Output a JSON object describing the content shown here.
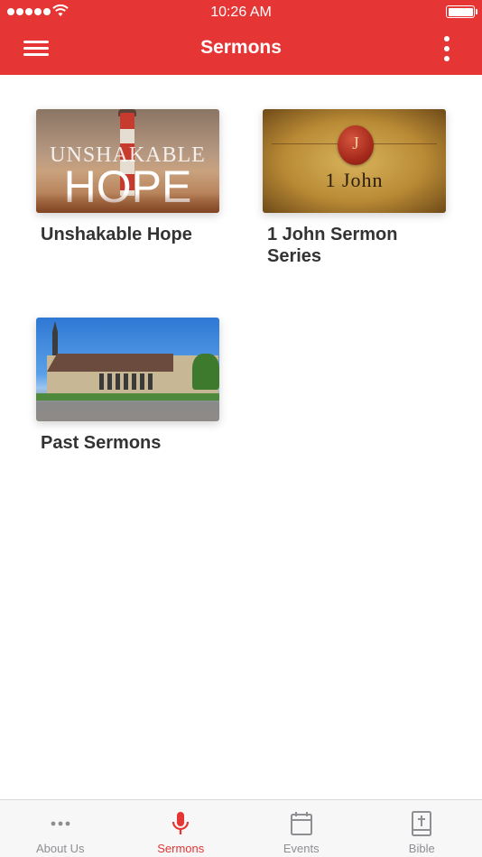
{
  "status_bar": {
    "time": "10:26 AM"
  },
  "header": {
    "title": "Sermons",
    "background_color": "#e63535",
    "menu_icon": "hamburger-menu-icon",
    "more_icon": "more-vertical-icon"
  },
  "sermons": [
    {
      "title": "Unshakable Hope",
      "thumbnail_text_top": "UNSHAKABLE",
      "thumbnail_text_bottom": "HOPE"
    },
    {
      "title": "1 John Sermon Series",
      "thumbnail_seal_letter": "J",
      "thumbnail_text": "1 John"
    },
    {
      "title": "Past Sermons"
    }
  ],
  "tabs": [
    {
      "label": "About Us",
      "icon": "more-dots-icon",
      "active": false
    },
    {
      "label": "Sermons",
      "icon": "microphone-icon",
      "active": true
    },
    {
      "label": "Events",
      "icon": "calendar-icon",
      "active": false
    },
    {
      "label": "Bible",
      "icon": "bible-icon",
      "active": false
    }
  ],
  "colors": {
    "accent": "#e63535",
    "tab_inactive": "#8e8e93"
  }
}
